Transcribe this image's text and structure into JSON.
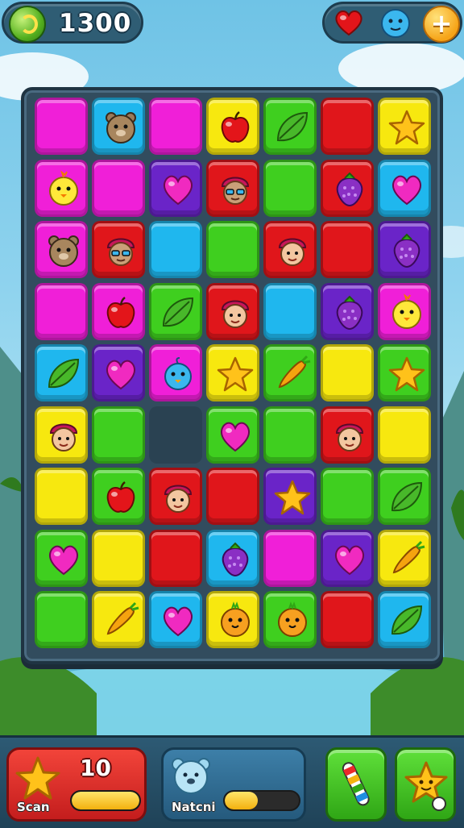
{
  "hud": {
    "score": "1300",
    "score_icon": "green-coin-icon",
    "right_icons": [
      "heart-life-icon",
      "blue-creature-icon",
      "plus-icon"
    ],
    "plus_label": "+"
  },
  "board": {
    "rows": 9,
    "cols": 7,
    "colors": {
      "M": "#f01fd8",
      "C": "#1fb7ee",
      "Y": "#f7e80f",
      "G": "#3fcf1f",
      "R": "#e0161b",
      "P": "#6a24c8"
    },
    "cells": [
      [
        [
          "M",
          ""
        ],
        [
          "C",
          "bear"
        ],
        [
          "M",
          ""
        ],
        [
          "Y",
          "apple"
        ],
        [
          "G",
          "leaf"
        ],
        [
          "R",
          ""
        ],
        [
          "Y",
          "star"
        ]
      ],
      [
        [
          "M",
          "chick"
        ],
        [
          "M",
          ""
        ],
        [
          "P",
          "heart"
        ],
        [
          "R",
          "kid-glasses"
        ],
        [
          "G",
          ""
        ],
        [
          "R",
          "berry"
        ],
        [
          "C",
          "heart"
        ]
      ],
      [
        [
          "M",
          "bear"
        ],
        [
          "R",
          "kid-glasses"
        ],
        [
          "C",
          ""
        ],
        [
          "G",
          ""
        ],
        [
          "R",
          "kid"
        ],
        [
          "R",
          ""
        ],
        [
          "P",
          "berry"
        ]
      ],
      [
        [
          "M",
          ""
        ],
        [
          "M",
          "apple"
        ],
        [
          "G",
          "leaf"
        ],
        [
          "R",
          "kid"
        ],
        [
          "C",
          ""
        ],
        [
          "P",
          "berry"
        ],
        [
          "M",
          "chick"
        ]
      ],
      [
        [
          "C",
          "leaf"
        ],
        [
          "P",
          "heart"
        ],
        [
          "M",
          "bird"
        ],
        [
          "Y",
          "star"
        ],
        [
          "G",
          "carrot"
        ],
        [
          "Y",
          ""
        ],
        [
          "G",
          "star"
        ]
      ],
      [
        [
          "Y",
          "kid"
        ],
        [
          "G",
          ""
        ],
        [
          null,
          ""
        ],
        [
          "G",
          "heart"
        ],
        [
          "G",
          ""
        ],
        [
          "R",
          "kid"
        ],
        [
          "Y",
          ""
        ]
      ],
      [
        [
          "Y",
          ""
        ],
        [
          "G",
          "apple"
        ],
        [
          "R",
          "kid"
        ],
        [
          "R",
          ""
        ],
        [
          "P",
          "star"
        ],
        [
          "G",
          ""
        ],
        [
          "G",
          "leaf"
        ]
      ],
      [
        [
          "G",
          "heart"
        ],
        [
          "Y",
          ""
        ],
        [
          "R",
          ""
        ],
        [
          "C",
          "berry"
        ],
        [
          "M",
          ""
        ],
        [
          "P",
          "heart"
        ],
        [
          "Y",
          "carrot"
        ]
      ],
      [
        [
          "G",
          ""
        ],
        [
          "Y",
          "carrot"
        ],
        [
          "C",
          "heart"
        ],
        [
          "Y",
          "chick-orange"
        ],
        [
          "G",
          "chick-orange"
        ],
        [
          "R",
          ""
        ],
        [
          "C",
          "leaf"
        ]
      ]
    ]
  },
  "bottom": {
    "scan": {
      "label": "Scan",
      "count": "10",
      "icon": "star-icon",
      "progress": 1.0
    },
    "match": {
      "label": "Natcni",
      "icon": "bear-creature-icon",
      "progress": 0.45
    },
    "tools": [
      "candy-stick-icon",
      "star-face-icon"
    ]
  }
}
